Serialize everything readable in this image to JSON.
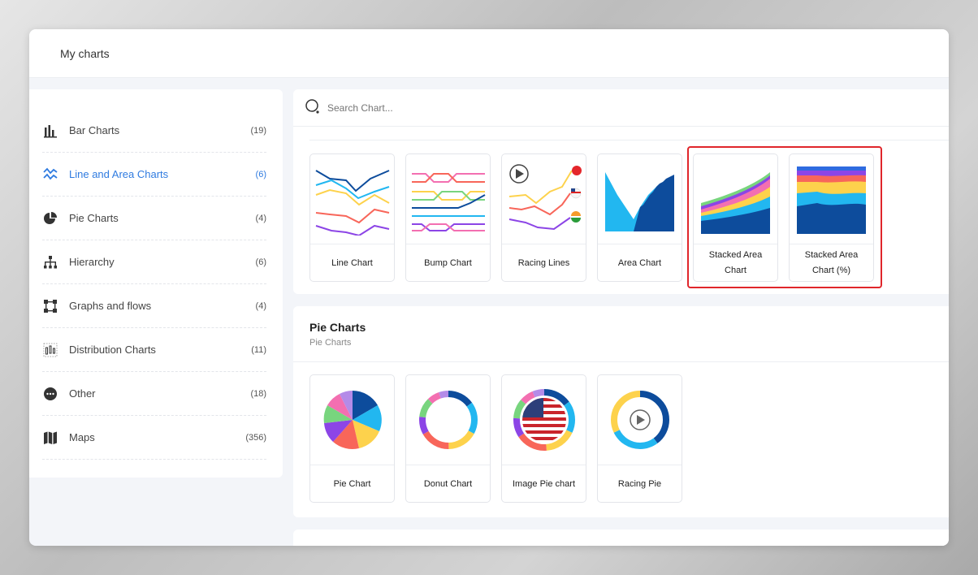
{
  "header": {
    "title": "My charts"
  },
  "sidebar": {
    "items": [
      {
        "label": "Bar Charts",
        "count": "(19)",
        "icon": "bar-chart-icon",
        "active": false
      },
      {
        "label": "Line and Area Charts",
        "count": "(6)",
        "icon": "line-chart-icon",
        "active": true
      },
      {
        "label": "Pie Charts",
        "count": "(4)",
        "icon": "pie-chart-icon",
        "active": false
      },
      {
        "label": "Hierarchy",
        "count": "(6)",
        "icon": "hierarchy-icon",
        "active": false
      },
      {
        "label": "Graphs and flows",
        "count": "(4)",
        "icon": "graph-icon",
        "active": false
      },
      {
        "label": "Distribution Charts",
        "count": "(11)",
        "icon": "distribution-icon",
        "active": false
      },
      {
        "label": "Other",
        "count": "(18)",
        "icon": "other-icon",
        "active": false
      },
      {
        "label": "Maps",
        "count": "(356)",
        "icon": "map-icon",
        "active": false
      }
    ],
    "active_color": "#2f7be0"
  },
  "search": {
    "placeholder": "Search Chart..."
  },
  "line_section": {
    "cards": [
      {
        "label": "Line Chart"
      },
      {
        "label": "Bump Chart"
      },
      {
        "label": "Racing Lines"
      },
      {
        "label": "Area Chart"
      },
      {
        "label": "Stacked Area Chart"
      },
      {
        "label": "Stacked Area Chart (%)"
      }
    ]
  },
  "pie_section": {
    "title": "Pie Charts",
    "subtitle": "Pie Charts",
    "cards": [
      {
        "label": "Pie Chart"
      },
      {
        "label": "Donut Chart"
      },
      {
        "label": "Image Pie chart"
      },
      {
        "label": "Racing Pie"
      }
    ]
  },
  "colors": {
    "highlight": "#e0262b",
    "navy": "#0d4c9c",
    "sky": "#22b7f0",
    "yellow": "#fdd24c",
    "coral": "#f8665a",
    "purple": "#8c45e6",
    "green": "#78d57e",
    "pink": "#f36fb1"
  }
}
